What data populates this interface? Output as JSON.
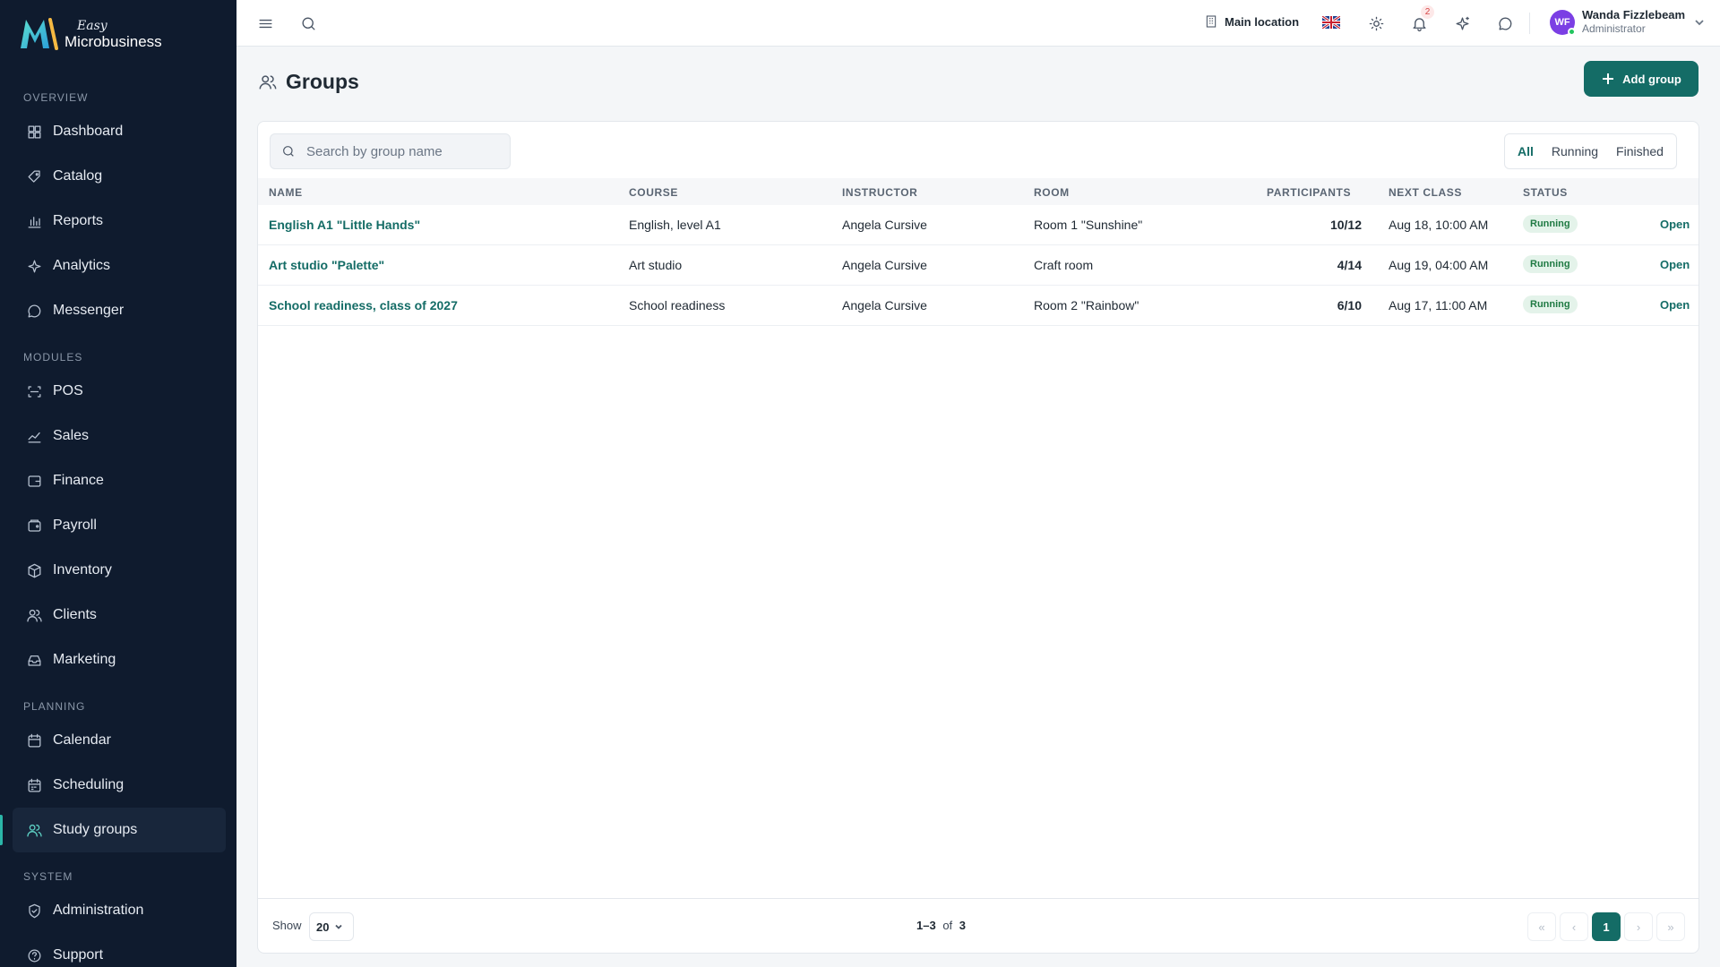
{
  "brand": {
    "easy": "Easy",
    "name": "Microbusiness"
  },
  "sidebar": {
    "sections": [
      {
        "title": "OVERVIEW",
        "items": [
          {
            "label": "Dashboard",
            "icon": "dashboard-icon"
          },
          {
            "label": "Catalog",
            "icon": "catalog-icon"
          },
          {
            "label": "Reports",
            "icon": "reports-icon"
          },
          {
            "label": "Analytics",
            "icon": "analytics-icon"
          },
          {
            "label": "Messenger",
            "icon": "messenger-icon"
          }
        ]
      },
      {
        "title": "MODULES",
        "items": [
          {
            "label": "POS",
            "icon": "pos-icon"
          },
          {
            "label": "Sales",
            "icon": "sales-icon"
          },
          {
            "label": "Finance",
            "icon": "finance-icon"
          },
          {
            "label": "Payroll",
            "icon": "payroll-icon"
          },
          {
            "label": "Inventory",
            "icon": "inventory-icon"
          },
          {
            "label": "Clients",
            "icon": "clients-icon"
          },
          {
            "label": "Marketing",
            "icon": "marketing-icon"
          }
        ]
      },
      {
        "title": "PLANNING",
        "items": [
          {
            "label": "Calendar",
            "icon": "calendar-icon"
          },
          {
            "label": "Scheduling",
            "icon": "scheduling-icon"
          },
          {
            "label": "Study groups",
            "icon": "study-groups-icon",
            "active": true
          }
        ]
      },
      {
        "title": "SYSTEM",
        "items": [
          {
            "label": "Administration",
            "icon": "administration-icon"
          },
          {
            "label": "Support",
            "icon": "support-icon"
          }
        ]
      }
    ]
  },
  "topbar": {
    "location": "Main location",
    "notifications_count": "2",
    "user": {
      "initials": "WF",
      "name": "Wanda Fizzlebeam",
      "role": "Administrator"
    }
  },
  "page": {
    "title": "Groups",
    "add_button": "Add group"
  },
  "search": {
    "placeholder": "Search by group name",
    "value": ""
  },
  "filters": [
    {
      "label": "All",
      "active": true
    },
    {
      "label": "Running",
      "active": false
    },
    {
      "label": "Finished",
      "active": false
    }
  ],
  "table": {
    "columns": [
      "NAME",
      "COURSE",
      "INSTRUCTOR",
      "ROOM",
      "PARTICIPANTS",
      "NEXT CLASS",
      "STATUS"
    ],
    "rows": [
      {
        "name": "English A1 \"Little Hands\"",
        "course": "English, level A1",
        "instructor": "Angela Cursive",
        "room": "Room 1 \"Sunshine\"",
        "participants": "10/12",
        "next_class": "Aug 18, 10:00 AM",
        "status": "Running",
        "action": "Open"
      },
      {
        "name": "Art studio \"Palette\"",
        "course": "Art studio",
        "instructor": "Angela Cursive",
        "room": "Craft room",
        "participants": "4/14",
        "next_class": "Aug 19, 04:00 AM",
        "status": "Running",
        "action": "Open"
      },
      {
        "name": "School readiness, class of 2027",
        "course": "School readiness",
        "instructor": "Angela Cursive",
        "room": "Room 2 \"Rainbow\"",
        "participants": "6/10",
        "next_class": "Aug 17, 11:00 AM",
        "status": "Running",
        "action": "Open"
      }
    ]
  },
  "footer": {
    "show_label": "Show",
    "page_size": "20",
    "range": "1–3",
    "of_label": "of",
    "total": "3",
    "current_page": "1"
  },
  "colors": {
    "sidebar_bg": "#0f1b2e",
    "accent": "#146c66",
    "status_running_bg": "#e4f3ea",
    "status_running_text": "#1f7a43",
    "avatar": "#7b3fe4"
  }
}
